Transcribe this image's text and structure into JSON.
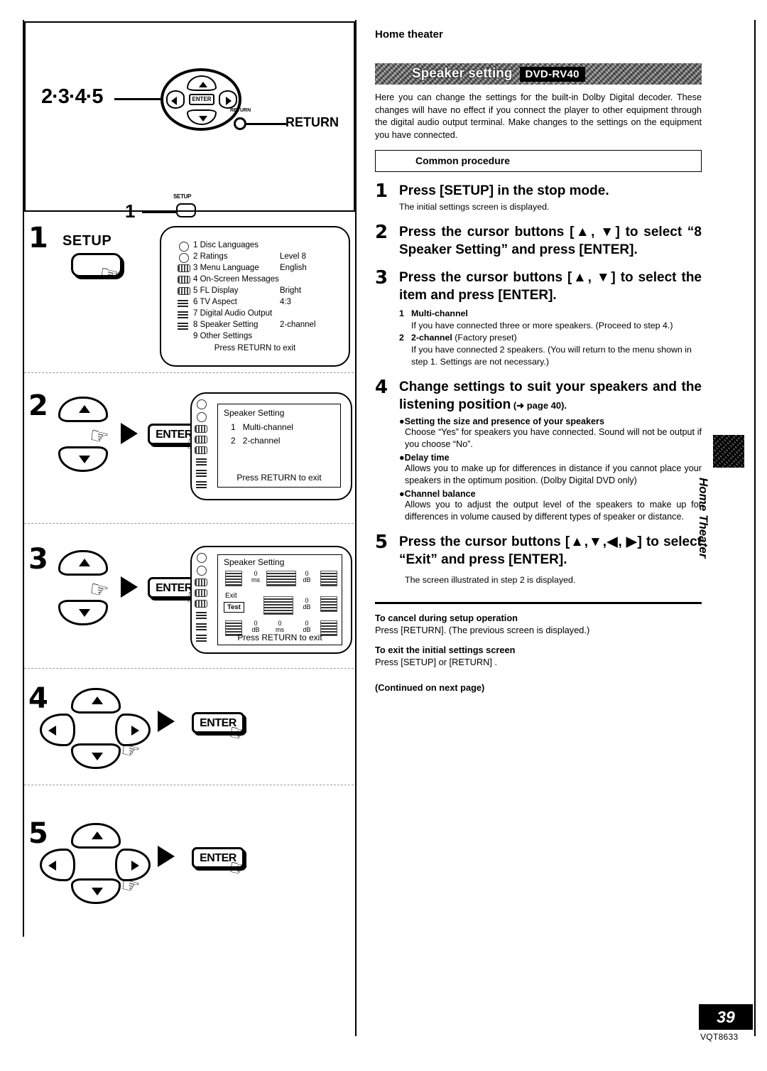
{
  "page": {
    "header": "Home theater",
    "number": "39",
    "doc_code": "VQT8633",
    "side_tab": "Home Theater",
    "continued": "(Continued on next page)"
  },
  "banner": {
    "title": "Speaker setting",
    "model": "DVD-RV40"
  },
  "intro": "Here you can change the settings for the built-in Dolby Digital decoder. These changes will have no effect if you connect the player to other equipment through the digital audio output terminal. Make changes to the settings on the equipment you have connected.",
  "common_procedure_label": "Common procedure",
  "steps": [
    {
      "n": "1",
      "head": "Press [SETUP] in the stop mode.",
      "sub": "The initial settings screen is displayed."
    },
    {
      "n": "2",
      "head": "Press the cursor buttons [▲, ▼] to select “8 Speaker Setting” and press [ENTER]."
    },
    {
      "n": "3",
      "head": "Press the cursor buttons [▲, ▼] to select the item and press [ENTER].",
      "options": [
        {
          "n": "1",
          "title": "Multi-channel",
          "note": "",
          "text": "If you have connected three or more speakers. (Proceed to step 4.)"
        },
        {
          "n": "2",
          "title": "2-channel",
          "note": " (Factory preset)",
          "text": "If you have connected 2 speakers. (You will return to the menu shown in step 1. Settings are not necessary.)"
        }
      ]
    },
    {
      "n": "4",
      "head": "Change settings to suit your speakers and the listening position",
      "head_ref": " (➜ page 40).",
      "bullets": [
        {
          "title": "Setting the size and presence of your speakers",
          "text": "Choose “Yes” for speakers you have connected. Sound will not be output if you choose “No”."
        },
        {
          "title": "Delay time",
          "text": "Allows you to make up for differences in distance if you cannot place your speakers in the optimum position. (Dolby Digital DVD only)"
        },
        {
          "title": "Channel balance",
          "text": "Allows you to adjust the output level of the speakers to make up for differences in volume caused by different types of speaker or distance."
        }
      ]
    },
    {
      "n": "5",
      "head": "Press the cursor buttons [▲,▼,◀, ▶] to select “Exit” and press [ENTER].",
      "sub": "The screen illustrated in step 2 is displayed."
    }
  ],
  "notes": [
    {
      "title": "To cancel during setup operation",
      "text": "Press [RETURN]. (The previous screen is displayed.)"
    },
    {
      "title": "To exit the initial settings screen",
      "text": "Press [SETUP] or [RETURN] ."
    }
  ],
  "remote_diagram": {
    "cursor_label": "2·3·4·5",
    "return_label": "RETURN",
    "return_key_text": "RETURN",
    "setup_label": "1",
    "setup_key_text": "SETUP",
    "enter_key_text": "ENTER"
  },
  "illustrations": {
    "step1_num": "1",
    "step1_key": "SETUP",
    "step2_num": "2",
    "step3_num": "3",
    "step4_num": "4",
    "step5_num": "5",
    "enter_label": "ENTER"
  },
  "screens": {
    "initial_settings": {
      "items": [
        {
          "icon": "disc-icon",
          "num": "1",
          "label": "Disc Languages",
          "value": ""
        },
        {
          "icon": "disc-icon",
          "num": "2",
          "label": "Ratings",
          "value": "Level 8"
        },
        {
          "icon": "bar-icon",
          "num": "3",
          "label": "Menu Language",
          "value": "English"
        },
        {
          "icon": "bar-icon",
          "num": "4",
          "label": "On-Screen Messages",
          "value": ""
        },
        {
          "icon": "bar-icon",
          "num": "5",
          "label": "FL Display",
          "value": "Bright"
        },
        {
          "icon": "speaker-icon",
          "num": "6",
          "label": "TV Aspect",
          "value": "4:3"
        },
        {
          "icon": "speaker-icon",
          "num": "7",
          "label": "Digital Audio Output",
          "value": ""
        },
        {
          "icon": "speaker-icon",
          "num": "8",
          "label": "Speaker Setting",
          "value": "2-channel"
        },
        {
          "icon": "none",
          "num": "9",
          "label": "Other Settings",
          "value": ""
        }
      ],
      "footer": "Press RETURN to exit"
    },
    "speaker_setting_menu": {
      "title": "Speaker Setting",
      "items": [
        {
          "num": "1",
          "label": "Multi-channel"
        },
        {
          "num": "2",
          "label": "2-channel"
        }
      ],
      "footer": "Press RETURN to exit"
    },
    "speaker_layout": {
      "title": "Speaker Setting",
      "footer": "Press RETURN to exit",
      "exit_label": "Exit",
      "test_label": "Test",
      "values": [
        {
          "pos": "front-left-delay",
          "value": "0",
          "unit": "ms"
        },
        {
          "pos": "center-level",
          "value": "0",
          "unit": "dB"
        },
        {
          "pos": "right-level",
          "value": "0",
          "unit": "dB"
        },
        {
          "pos": "surround-left",
          "value": "0",
          "unit": "dB"
        },
        {
          "pos": "surround-delay",
          "value": "0",
          "unit": "ms"
        },
        {
          "pos": "surround-right",
          "value": "0",
          "unit": "dB"
        }
      ]
    }
  }
}
